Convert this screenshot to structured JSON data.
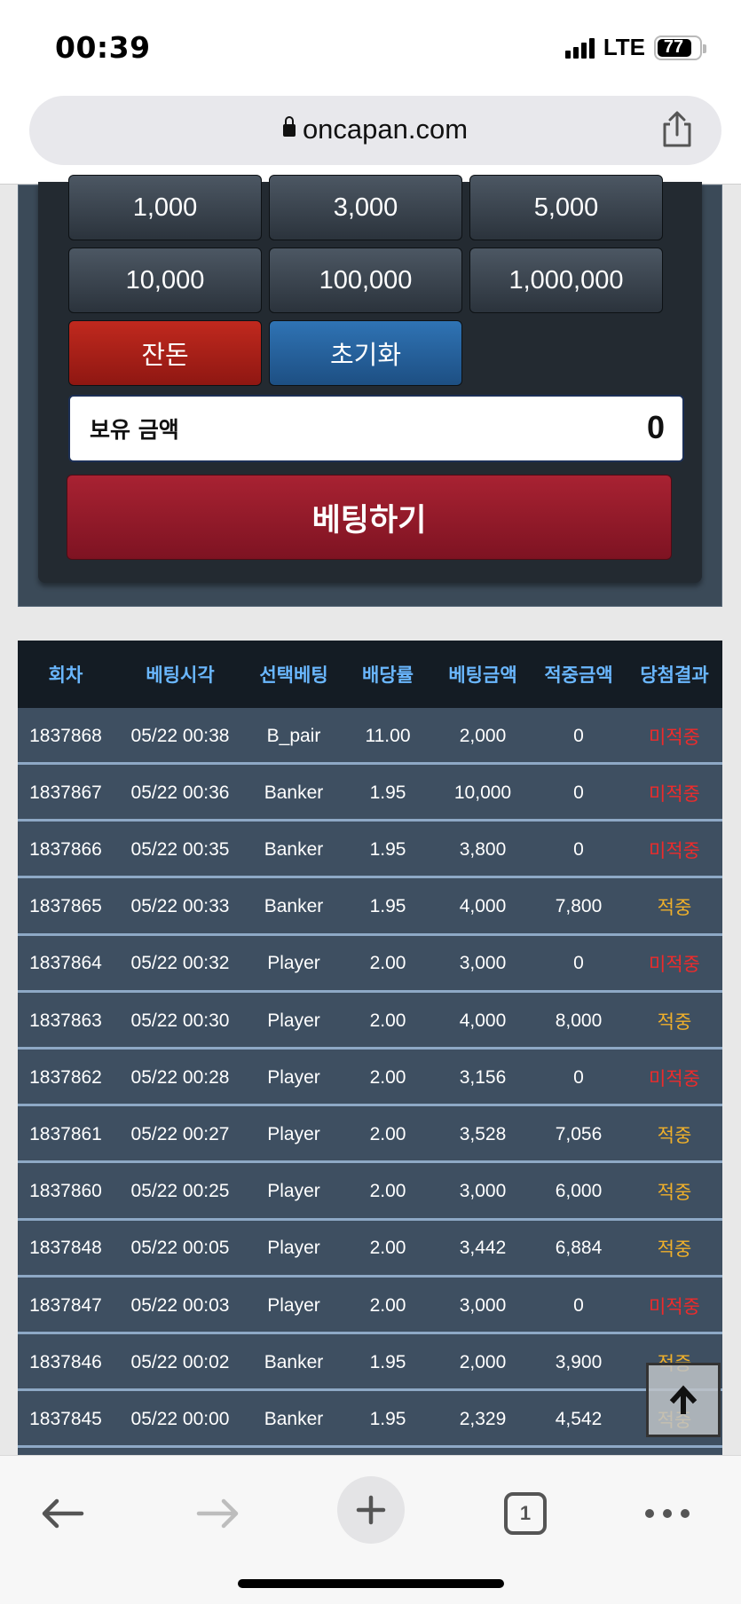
{
  "status": {
    "time": "00:39",
    "network": "LTE",
    "battery": "77"
  },
  "browser": {
    "url": "oncapan.com"
  },
  "chips": [
    "1,000",
    "3,000",
    "5,000",
    "10,000",
    "100,000",
    "1,000,000"
  ],
  "actions": {
    "change": "잔돈",
    "reset": "초기화",
    "bet": "베팅하기"
  },
  "balance": {
    "label": "보유 금액",
    "value": "0"
  },
  "table": {
    "headers": [
      "회차",
      "베팅시각",
      "선택베팅",
      "배당률",
      "베팅금액",
      "적중금액",
      "당첨결과"
    ],
    "rows": [
      {
        "round": "1837868",
        "time": "05/22 00:38",
        "pick": "B_pair",
        "odds": "11.00",
        "bet": "2,000",
        "win": "0",
        "result": "미적중",
        "hit": false
      },
      {
        "round": "1837867",
        "time": "05/22 00:36",
        "pick": "Banker",
        "odds": "1.95",
        "bet": "10,000",
        "win": "0",
        "result": "미적중",
        "hit": false
      },
      {
        "round": "1837866",
        "time": "05/22 00:35",
        "pick": "Banker",
        "odds": "1.95",
        "bet": "3,800",
        "win": "0",
        "result": "미적중",
        "hit": false
      },
      {
        "round": "1837865",
        "time": "05/22 00:33",
        "pick": "Banker",
        "odds": "1.95",
        "bet": "4,000",
        "win": "7,800",
        "result": "적중",
        "hit": true
      },
      {
        "round": "1837864",
        "time": "05/22 00:32",
        "pick": "Player",
        "odds": "2.00",
        "bet": "3,000",
        "win": "0",
        "result": "미적중",
        "hit": false
      },
      {
        "round": "1837863",
        "time": "05/22 00:30",
        "pick": "Player",
        "odds": "2.00",
        "bet": "4,000",
        "win": "8,000",
        "result": "적중",
        "hit": true
      },
      {
        "round": "1837862",
        "time": "05/22 00:28",
        "pick": "Player",
        "odds": "2.00",
        "bet": "3,156",
        "win": "0",
        "result": "미적중",
        "hit": false
      },
      {
        "round": "1837861",
        "time": "05/22 00:27",
        "pick": "Player",
        "odds": "2.00",
        "bet": "3,528",
        "win": "7,056",
        "result": "적중",
        "hit": true
      },
      {
        "round": "1837860",
        "time": "05/22 00:25",
        "pick": "Player",
        "odds": "2.00",
        "bet": "3,000",
        "win": "6,000",
        "result": "적중",
        "hit": true
      },
      {
        "round": "1837848",
        "time": "05/22 00:05",
        "pick": "Player",
        "odds": "2.00",
        "bet": "3,442",
        "win": "6,884",
        "result": "적중",
        "hit": true
      },
      {
        "round": "1837847",
        "time": "05/22 00:03",
        "pick": "Player",
        "odds": "2.00",
        "bet": "3,000",
        "win": "0",
        "result": "미적중",
        "hit": false
      },
      {
        "round": "1837846",
        "time": "05/22 00:02",
        "pick": "Banker",
        "odds": "1.95",
        "bet": "2,000",
        "win": "3,900",
        "result": "적중",
        "hit": true
      },
      {
        "round": "1837845",
        "time": "05/22 00:00",
        "pick": "Banker",
        "odds": "1.95",
        "bet": "2,329",
        "win": "4,542",
        "result": "적중",
        "hit": true
      }
    ]
  },
  "toolbar": {
    "tab_count": "1"
  }
}
